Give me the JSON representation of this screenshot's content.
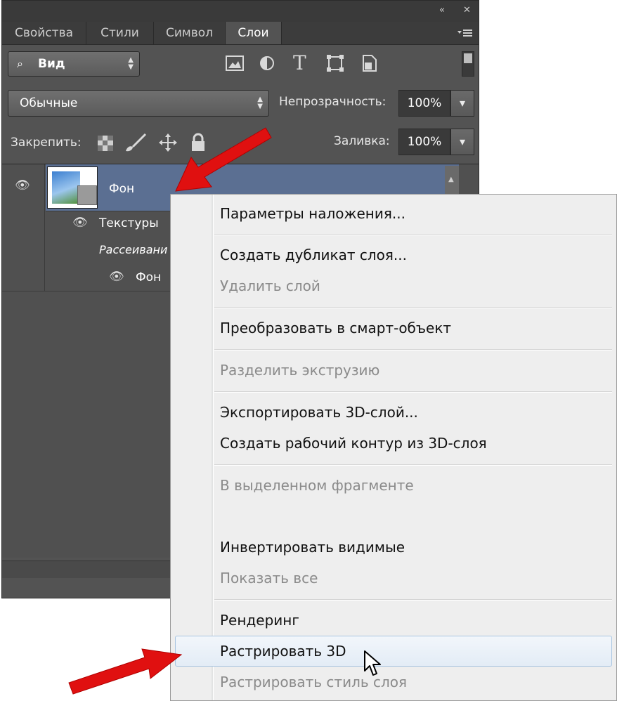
{
  "panel": {
    "tabs": [
      "Свойства",
      "Стили",
      "Символ",
      "Слои"
    ],
    "active_tab": "Слои",
    "filter_label": "Вид",
    "blend_mode": "Обычные",
    "opacity_label": "Непрозрачность:",
    "opacity_value": "100%",
    "lock_label": "Закрепить:",
    "fill_label": "Заливка:",
    "fill_value": "100%",
    "layers": [
      {
        "name": "Фон"
      },
      {
        "name": "Текстуры"
      },
      {
        "name": "Рассеивани"
      },
      {
        "name": "Фон"
      }
    ]
  },
  "context_menu": {
    "items": [
      {
        "label": "Параметры наложения...",
        "disabled": false
      },
      {
        "label": "Создать дубликат слоя...",
        "disabled": false
      },
      {
        "label": "Удалить слой",
        "disabled": true
      },
      {
        "label": "Преобразовать в смарт-объект",
        "disabled": false
      },
      {
        "label": "Разделить экструзию",
        "disabled": true
      },
      {
        "label": "Экспортировать 3D-слой...",
        "disabled": false
      },
      {
        "label": "Создать рабочий контур из 3D-слоя",
        "disabled": false
      },
      {
        "label": "В выделенном фрагменте",
        "disabled": true
      },
      {
        "label": "Инвертировать видимые",
        "disabled": false
      },
      {
        "label": "Показать все",
        "disabled": true
      },
      {
        "label": "Рендеринг",
        "disabled": false
      },
      {
        "label": "Растрировать 3D",
        "disabled": false,
        "highlighted": true
      },
      {
        "label": "Растрировать стиль слоя",
        "disabled": true
      }
    ]
  },
  "icons": {
    "collapse": "double-chevron-icon",
    "close": "close-icon",
    "panel_menu": "panel-menu-icon",
    "search": "search-icon",
    "eye": "eye-icon",
    "cursor": "mouse-cursor-icon",
    "arrow": "red-arrow-annotation"
  },
  "colors": {
    "panel_bg": "#535353",
    "selection": "#5b6f92",
    "menu_bg": "#eeeeee",
    "arrow": "#e01010"
  }
}
